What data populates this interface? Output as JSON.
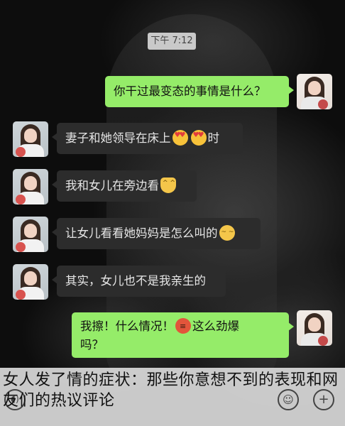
{
  "chat": {
    "timestamp": "下午 7:12",
    "messages": [
      {
        "side": "out",
        "text": "你干过最变态的事情是什么？"
      },
      {
        "side": "in",
        "text": "妻子和她领导在床上",
        "after": "时"
      },
      {
        "side": "in",
        "text": "我和女儿在旁边看"
      },
      {
        "side": "in",
        "text": "让女儿看看她妈妈是怎么叫的"
      },
      {
        "side": "in",
        "text": "其实，女儿也不是我亲生的"
      },
      {
        "side": "out",
        "text": "我擦！什么情况！",
        "after": "这么劲爆",
        "line2": "吗？"
      }
    ],
    "emojis": [
      "heart-eyes",
      "heart-eyes",
      "smiling-cat",
      "persevering-face",
      "angry-face"
    ]
  },
  "caption": "女人发了情的症状：那些你意想不到的表现和网友们的热议评论",
  "toolbar": {
    "voice_icon": "voice-icon",
    "emoji_icon": "emoji-icon",
    "plus_icon": "plus-icon"
  },
  "colors": {
    "sent_bubble": "#95ec69",
    "received_bubble": "#2c2c2c",
    "timestamp_bg": "#c9c9c9"
  }
}
